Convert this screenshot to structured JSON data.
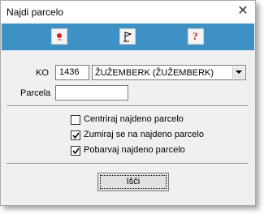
{
  "window": {
    "title": "Najdi parcelo"
  },
  "toolbar": {
    "icons": [
      "point-icon",
      "flag-icon",
      "help-icon"
    ]
  },
  "form": {
    "ko_label": "KO",
    "ko_code": "1436",
    "ko_name": "ŽUŽEMBERK (ŽUŽEMBERK)",
    "parcela_label": "Parcela",
    "parcela_value": ""
  },
  "options": [
    {
      "label": "Centriraj najdeno parcelo",
      "checked": false
    },
    {
      "label": "Zumiraj se na najdeno parcelo",
      "checked": true
    },
    {
      "label": "Pobarvaj najdeno parcelo",
      "checked": true
    }
  ],
  "buttons": {
    "search_label": "Išči"
  }
}
